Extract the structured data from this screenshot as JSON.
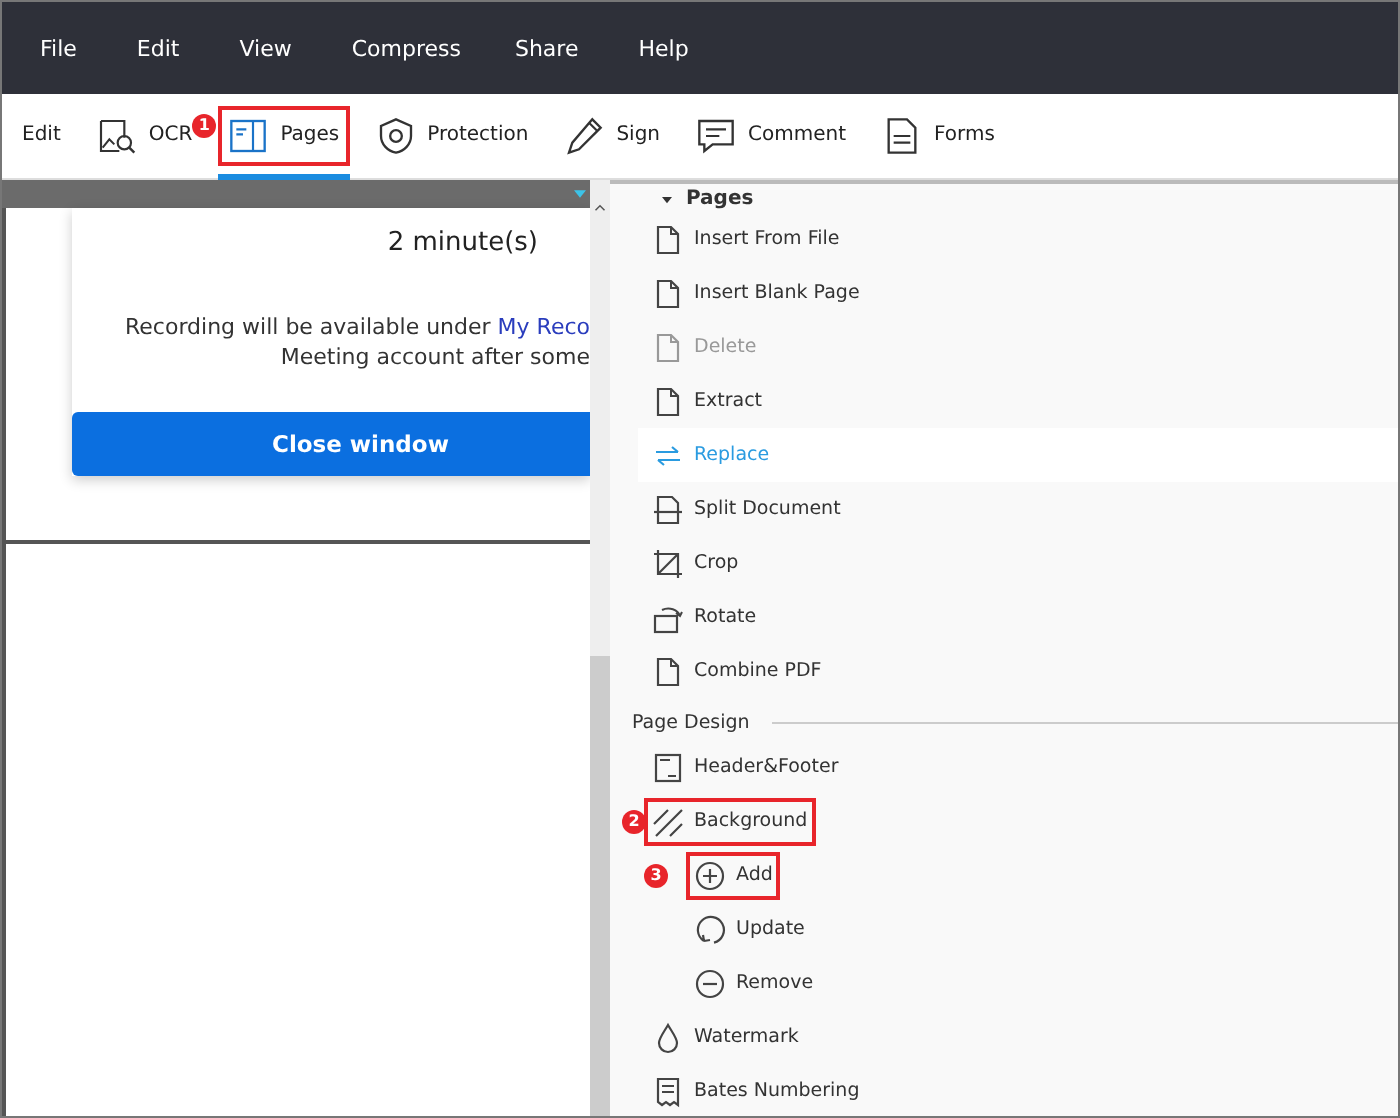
{
  "menu": [
    "File",
    "Edit",
    "View",
    "Compress",
    "Share",
    "Help"
  ],
  "toolbar": [
    {
      "label": "Edit",
      "selected": false
    },
    {
      "label": "OCR",
      "selected": false
    },
    {
      "label": "Pages",
      "selected": true,
      "callout": "1"
    },
    {
      "label": "Protection",
      "selected": false
    },
    {
      "label": "Sign",
      "selected": false
    },
    {
      "label": "Comment",
      "selected": false
    },
    {
      "label": "Forms",
      "selected": false
    }
  ],
  "document": {
    "duration": "2 minute(s)",
    "message_start": "Recording will be available under ",
    "message_link": "My Reco",
    "message_end": "Meeting account after some",
    "button": "Close window"
  },
  "panel": {
    "sections": [
      {
        "title": "Pages",
        "expanded": true,
        "items": [
          {
            "label": "Insert From File",
            "disabled": false,
            "selected": false
          },
          {
            "label": "Insert Blank Page",
            "disabled": false,
            "selected": false
          },
          {
            "label": "Delete",
            "disabled": true,
            "selected": false
          },
          {
            "label": "Extract",
            "disabled": false,
            "selected": false
          },
          {
            "label": "Replace",
            "disabled": false,
            "selected": true
          },
          {
            "label": "Split Document",
            "disabled": false,
            "selected": false
          },
          {
            "label": "Crop",
            "disabled": false,
            "selected": false
          },
          {
            "label": "Rotate",
            "disabled": false,
            "selected": false
          },
          {
            "label": "Combine PDF",
            "disabled": false,
            "selected": false
          }
        ]
      },
      {
        "title": "Page Design",
        "items": [
          {
            "label": "Header&Footer",
            "disabled": false,
            "selected": false
          },
          {
            "label": "Background",
            "disabled": false,
            "selected": false,
            "callout": "2",
            "children": [
              {
                "label": "Add",
                "disabled": false,
                "selected": false,
                "callout": "3"
              },
              {
                "label": "Update",
                "disabled": false,
                "selected": false
              },
              {
                "label": "Remove",
                "disabled": false,
                "selected": false
              }
            ]
          },
          {
            "label": "Watermark",
            "disabled": false,
            "selected": false
          },
          {
            "label": "Bates Numbering",
            "disabled": false,
            "selected": false
          }
        ]
      }
    ]
  }
}
